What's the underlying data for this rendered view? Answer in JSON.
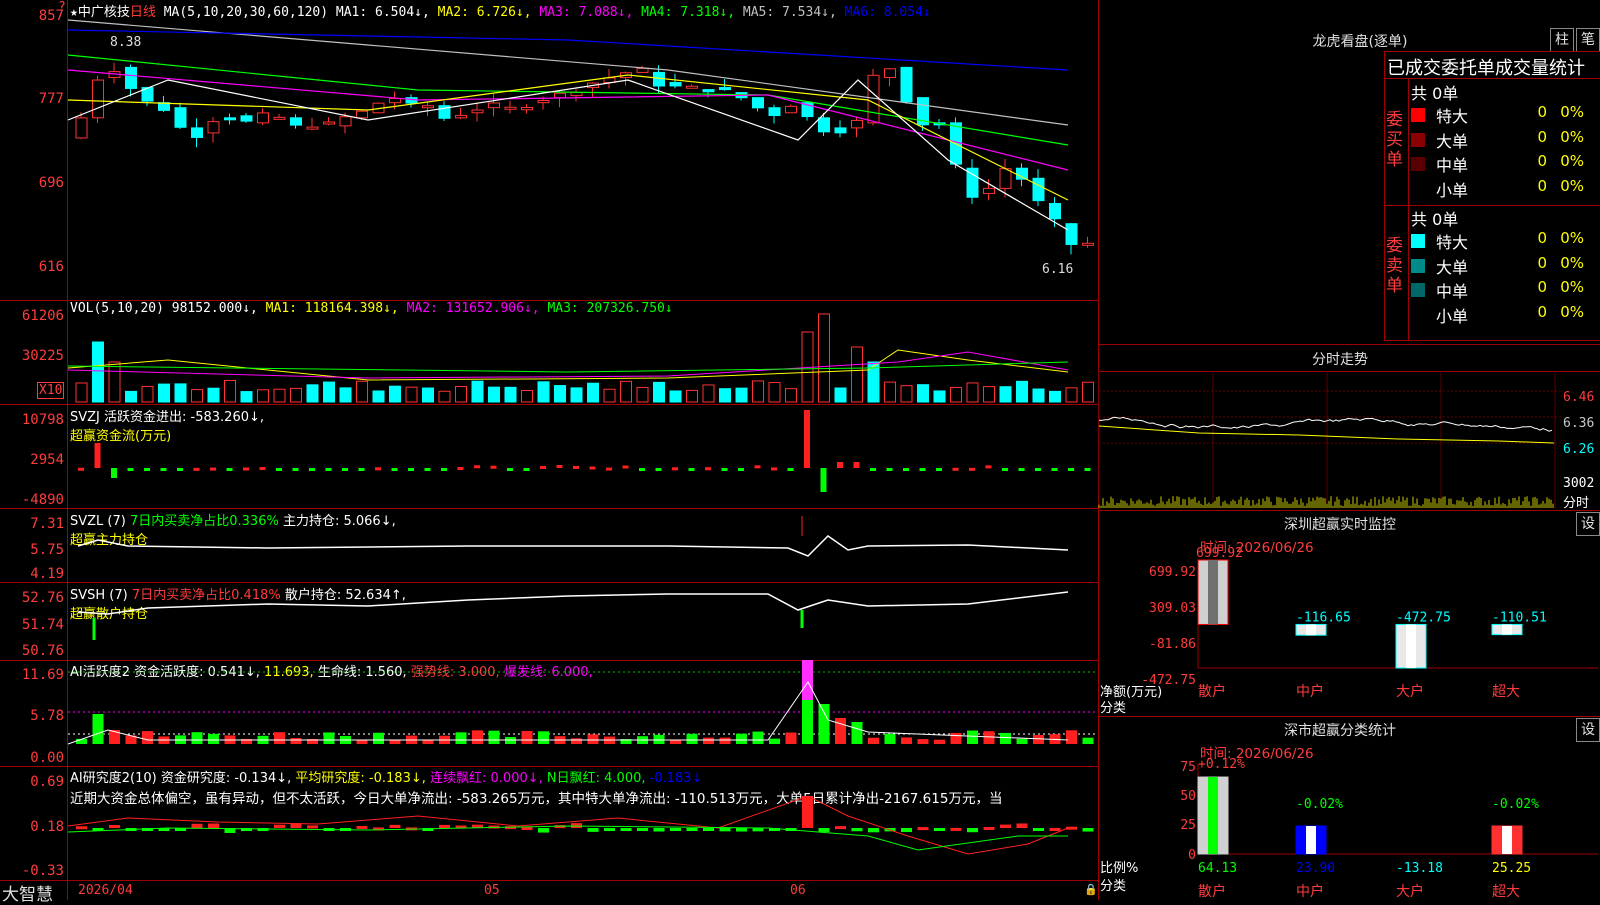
{
  "stock": {
    "star": "★",
    "name": "中广核技",
    "period": "日线"
  },
  "price_panel": {
    "ma_prefix": "MA(5,10,20,30,60,120)",
    "ma1": "MA1: 6.504↓,",
    "ma2": "MA2: 6.726↓,",
    "ma3": "MA3: 7.088↓,",
    "ma4": "MA4: 7.318↓,",
    "ma5": "MA5: 7.534↓,",
    "ma6": "MA6: 8.054↓",
    "axis": [
      "857",
      "777",
      "696",
      "616"
    ],
    "high_label": "8.38",
    "low_label": "6.16"
  },
  "vol_panel": {
    "title": "VOL(5,10,20)",
    "cur": "98152.000↓,",
    "ma1": "MA1: 118164.398↓,",
    "ma2": "MA2: 131652.906↓,",
    "ma3": "MA3: 207326.750↓",
    "axis": [
      "61206",
      "30225"
    ],
    "unit": "X10"
  },
  "svzj_panel": {
    "title": "SVZJ",
    "text": "活跃资金进出: -583.260↓,",
    "sub": "超赢资金流(万元)",
    "axis": [
      "10798",
      "2954",
      "-4890"
    ]
  },
  "svzl_panel": {
    "title": "SVZL (7)",
    "text1": "7日内买卖净占比0.336%",
    "text2": "主力持仓: 5.066↓,",
    "sub": "超赢主力持仓",
    "axis": [
      "7.31",
      "5.75",
      "4.19"
    ]
  },
  "svsh_panel": {
    "title": "SVSH (7)",
    "text1": "7日内买卖净占比0.418%",
    "text2": "散户持仓: 52.634↑,",
    "sub": "超赢散户持仓",
    "axis": [
      "52.76",
      "51.74",
      "50.76"
    ]
  },
  "ai1_panel": {
    "title": "AI活跃度2",
    "t1": "资金活跃度: 0.541↓,",
    "t2": "11.693,",
    "t3": "生命线: 1.560,",
    "t4": "强势线: 3.000,",
    "t5": "爆发线: 6.000,",
    "axis": [
      "11.69",
      "5.78",
      "0.00"
    ]
  },
  "ai2_panel": {
    "title": "AI研究度2(10)",
    "t1": "资金研究度: -0.134↓,",
    "t2": "平均研究度: -0.183↓,",
    "t3": "连续飘红: 0.000↓,",
    "t4": "N日飘红: 4.000,",
    "t5": "-0.183↓",
    "desc": "近期大资金总体偏空，虽有异动，但不太活跃，今日大单净流出: -583.265万元，其中特大单净流出: -110.513万元，大单5日累计净出-2167.615万元，当",
    "axis": [
      "0.69",
      "0.18",
      "-0.33"
    ]
  },
  "bottom": {
    "logo": "大智慧",
    "date": "2026/04",
    "m5": "05",
    "m6": "06"
  },
  "lhb": {
    "title": "龙虎看盘(逐单)",
    "btn_zhu": "柱",
    "btn_bi": "笔",
    "header": "已成交委托单成交量统计",
    "buy_label": "委买单",
    "buy_total": "共 0单",
    "buy_rows": [
      {
        "name": "特大",
        "n": "0",
        "p": "0%",
        "color": "#ff0000"
      },
      {
        "name": "大单",
        "n": "0",
        "p": "0%",
        "color": "#8b0000"
      },
      {
        "name": "中单",
        "n": "0",
        "p": "0%",
        "color": "#5a0000"
      },
      {
        "name": "小单",
        "n": "0",
        "p": "0%",
        "color": ""
      }
    ],
    "sell_label": "委卖单",
    "sell_total": "共 0单",
    "sell_rows": [
      {
        "name": "特大",
        "n": "0",
        "p": "0%",
        "color": "#00ffff"
      },
      {
        "name": "大单",
        "n": "0",
        "p": "0%",
        "color": "#008b8b"
      },
      {
        "name": "中单",
        "n": "0",
        "p": "0%",
        "color": "#006868"
      },
      {
        "name": "小单",
        "n": "0",
        "p": "0%",
        "color": ""
      }
    ]
  },
  "fenshi": {
    "title": "分时走势",
    "axis": [
      "6.46",
      "6.36",
      "6.26"
    ],
    "vol_axis": "3002",
    "vol_label": "分时"
  },
  "monitor": {
    "title": "深圳超赢实时监控",
    "btn": "设",
    "time": "时间: 2026/06/26",
    "axis": [
      "699.92",
      "309.03",
      "-81.86",
      "-472.75"
    ],
    "ylabel1": "净额(万元)",
    "ylabel2": "分类",
    "cats": [
      "散户",
      "中户",
      "大户",
      "超大"
    ],
    "values": [
      699.92,
      -116.65,
      -472.75,
      -110.51
    ],
    "value_labels": [
      "699.92",
      "-116.65",
      "-472.75",
      "-110.51"
    ]
  },
  "classify": {
    "title": "深市超赢分类统计",
    "btn": "设",
    "time": "时间: 2026/06/26",
    "axis": [
      "75",
      "50",
      "25",
      "0"
    ],
    "top_labels": [
      "+0.12%",
      "-0.02%",
      "-0.02%"
    ],
    "ylabel1": "比例%",
    "ylabel2": "分类",
    "cats": [
      "散户",
      "中户",
      "大户",
      "超大"
    ],
    "values": [
      64.13,
      23.9,
      -13.18,
      25.25
    ],
    "value_labels": [
      "64.13",
      "23.90",
      "-13.18",
      "25.25"
    ]
  }
}
